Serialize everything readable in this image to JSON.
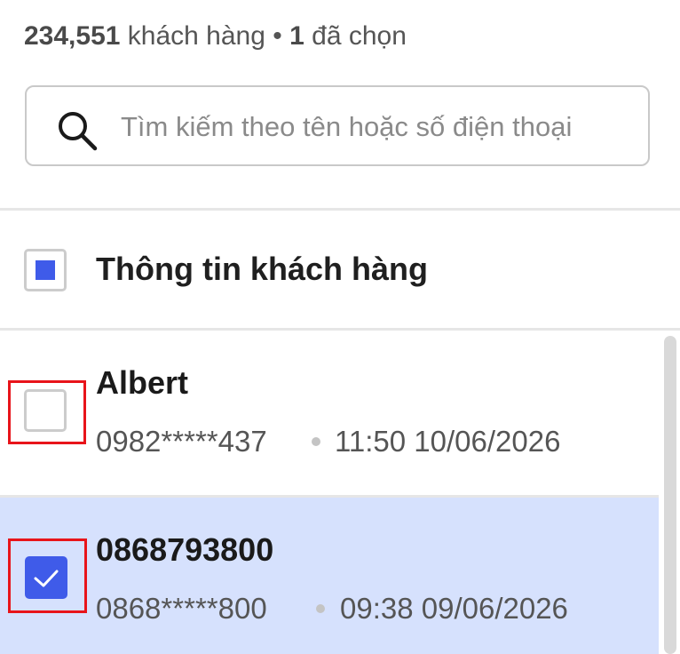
{
  "summary": {
    "total_count": "234,551",
    "total_label": "khách hàng",
    "separator": "•",
    "selected_count": "1",
    "selected_label": "đã chọn"
  },
  "search": {
    "placeholder": "Tìm kiếm theo tên hoặc số điện thoại",
    "value": "",
    "icon": "search-icon"
  },
  "list_header": {
    "label": "Thông tin khách hàng",
    "checkbox_state": "indeterminate"
  },
  "customers": [
    {
      "name": "Albert",
      "phone": "0982*****437",
      "time": "11:50 10/06/2026",
      "selected": false
    },
    {
      "name": "0868793800",
      "phone": "0868*****800",
      "time": "09:38 09/06/2026",
      "selected": true
    }
  ],
  "colors": {
    "accent": "#3f5be9",
    "selected_row_bg": "#d6e1fd",
    "highlight_frame": "#e8141a"
  }
}
